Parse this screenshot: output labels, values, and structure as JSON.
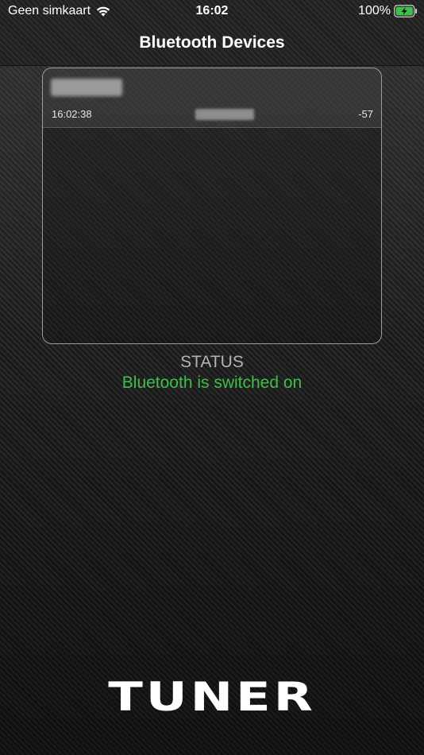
{
  "status_bar": {
    "carrier": "Geen simkaart",
    "time": "16:02",
    "battery_percent": "100%",
    "battery_color": "#3fbf4a"
  },
  "nav": {
    "title": "Bluetooth Devices"
  },
  "devices": [
    {
      "time": "16:02:38",
      "rssi": "-57"
    }
  ],
  "status": {
    "heading": "STATUS",
    "message": "Bluetooth is switched on",
    "message_color": "#3fbf4a"
  },
  "logo": {
    "text": "TUNER"
  }
}
